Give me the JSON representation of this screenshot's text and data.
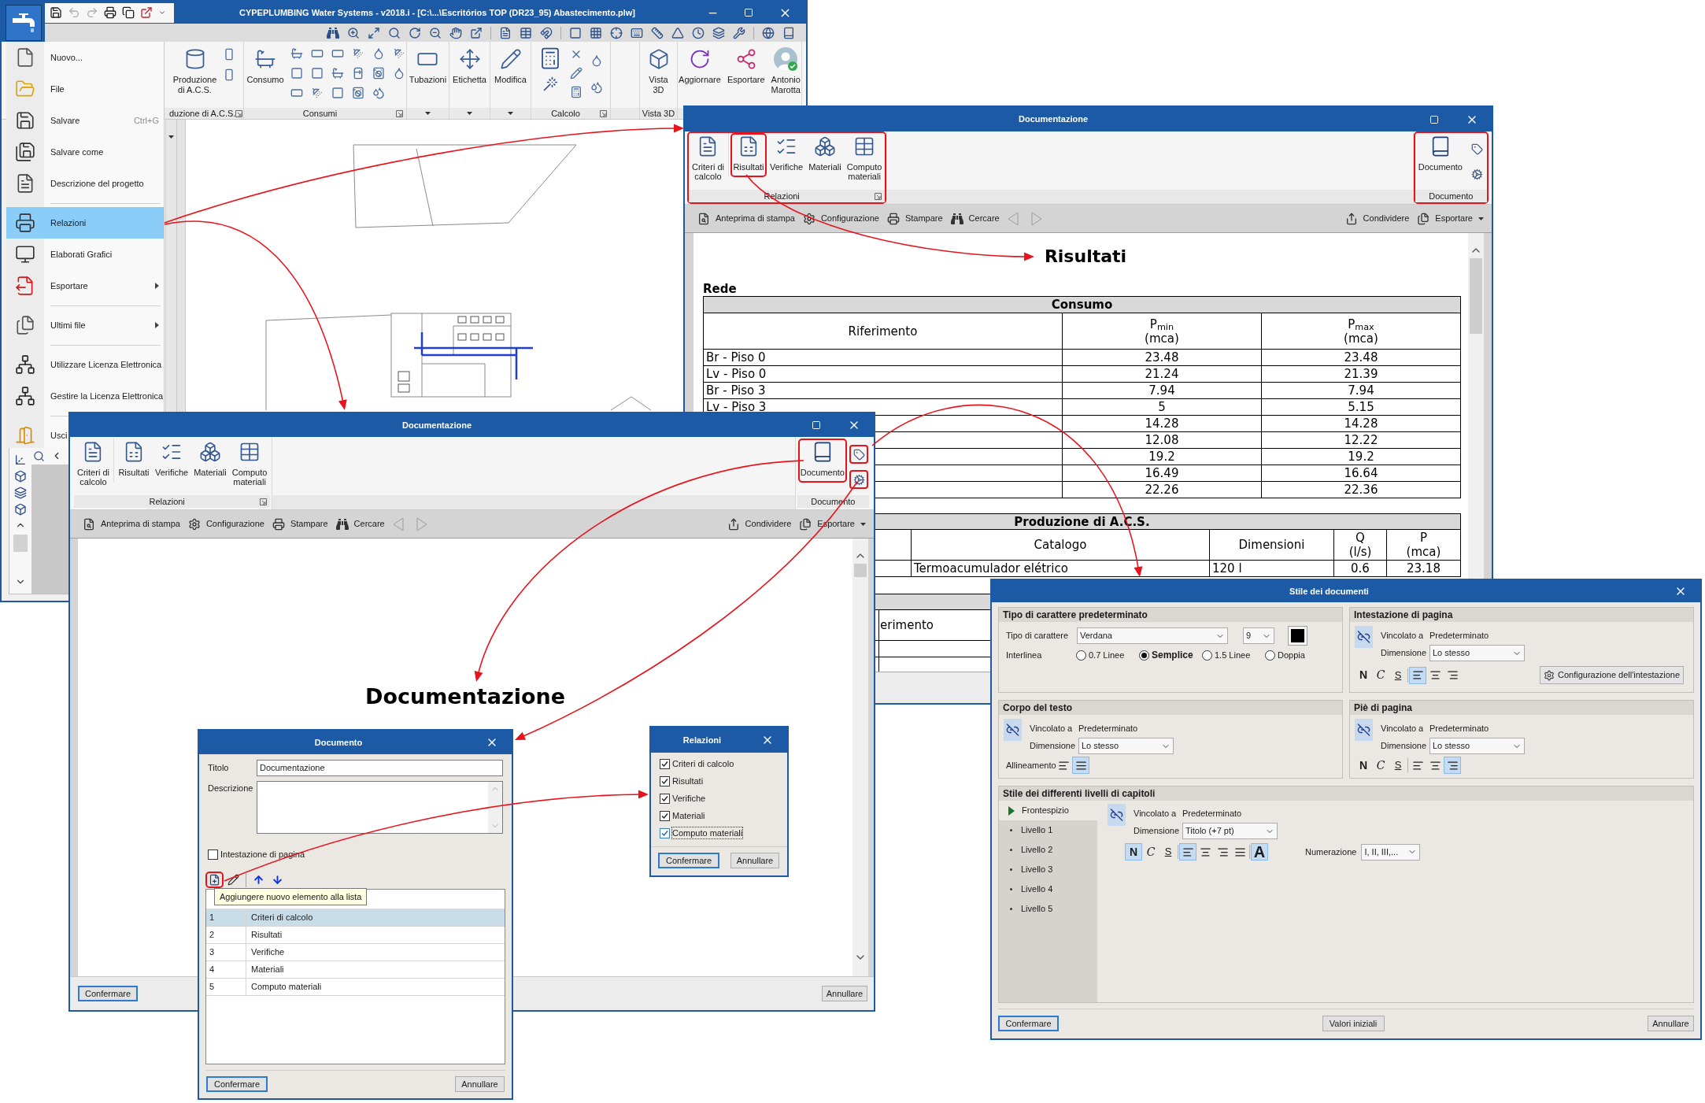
{
  "main_window": {
    "title": "CYPEPLUMBING Water Systems - v2018.i - [C:\\...\\Escritórios TOP (DR23_95) Abastecimento.plw]",
    "quick_access": [
      {
        "disabled": false
      },
      {
        "disabled": true
      },
      {
        "disabled": true
      },
      {
        "disabled": false
      },
      {
        "disabled": false
      },
      {
        "disabled": false
      }
    ],
    "ribbon_groups": [
      {
        "kind": "acs",
        "label": "duzione di A.C.S.",
        "launcher": true,
        "dropdown": false,
        "buttons": [
          "Produzione\ndi A.C.S."
        ]
      },
      {
        "kind": "consumption",
        "label": "Consumi",
        "launcher": true,
        "dropdown": false,
        "buttons": [
          "Consumo"
        ]
      },
      {
        "kind": "pipes",
        "launcher": false,
        "dropdown": true,
        "buttons": [
          "Tubazioni"
        ]
      },
      {
        "kind": "labels",
        "launcher": false,
        "dropdown": true,
        "buttons": [
          "Etichetta"
        ]
      },
      {
        "kind": "edit",
        "launcher": false,
        "dropdown": true,
        "buttons": [
          "Modifica"
        ]
      },
      {
        "kind": "calc",
        "label": "Calcolo",
        "launcher": true,
        "dropdown": false
      },
      {
        "kind": "view",
        "label": "Vista 3D",
        "launcher": false,
        "dropdown": false,
        "buttons": [
          "Vista\n3D"
        ]
      },
      {
        "kind": "share",
        "buttons": [
          "Aggiornare",
          "Esportare",
          "Antonio\nMarotta"
        ]
      }
    ],
    "app_menu": [
      {
        "label": "Nuovo...",
        "selected": false,
        "submenu": false,
        "divider": false
      },
      {
        "label": "File",
        "selected": false,
        "submenu": false,
        "divider": false
      },
      {
        "label": "Salvare",
        "shortcut": "Ctrl+G",
        "selected": false,
        "submenu": false,
        "divider": false
      },
      {
        "label": "Salvare come",
        "selected": false,
        "submenu": false,
        "divider": false
      },
      {
        "label": "Descrizione del progetto",
        "selected": false,
        "submenu": false,
        "divider": true
      },
      {
        "label": "Relazioni",
        "selected": true,
        "submenu": false,
        "divider": false
      },
      {
        "label": "Elaborati Grafici",
        "selected": false,
        "submenu": false,
        "divider": false
      },
      {
        "label": "Esportare",
        "selected": false,
        "submenu": true,
        "divider": true
      },
      {
        "label": "Ultimi file",
        "selected": false,
        "submenu": true,
        "divider": true
      },
      {
        "label": "Utilizzare Licenza Elettronica",
        "selected": false,
        "submenu": false,
        "divider": false
      },
      {
        "label": "Gestire la Licenza Elettronica",
        "selected": false,
        "submenu": false,
        "divider": true
      },
      {
        "label": "Usci",
        "selected": false,
        "submenu": false,
        "divider": false
      }
    ]
  },
  "report_window": {
    "title": "Documentazione",
    "ribbon_groups": [
      {
        "kind": "reports",
        "label": "Relazioni",
        "launcher": true,
        "highlighted": true,
        "buttons": [
          {
            "label": "Criteri di\ncalcolo",
            "highlighted": false
          },
          {
            "label": "Risultati",
            "highlighted": true
          },
          {
            "label": "Verifiche",
            "highlighted": false
          },
          {
            "label": "Materiali",
            "highlighted": false
          },
          {
            "label": "Computo\nmateriali",
            "highlighted": false
          }
        ]
      },
      {
        "kind": "document",
        "label": "Documento",
        "launcher": false,
        "highlighted": true,
        "buttons": [
          {
            "label": "Documento",
            "highlighted": false
          }
        ],
        "tools": [
          {
            "highlighted": false
          },
          {
            "highlighted": false
          }
        ]
      }
    ],
    "toolbar": {
      "left": [
        {
          "label": "Anteprima di stampa"
        },
        {
          "label": "Configurazione"
        },
        {
          "label": "Stampare"
        },
        {
          "label": "Cercare"
        }
      ],
      "nav": [
        {
          "disabled": true
        },
        {
          "disabled": true
        }
      ],
      "right": [
        {
          "label": "Condividere",
          "dropdown": false
        },
        {
          "label": "Esportare",
          "dropdown": true
        }
      ]
    },
    "document": {
      "heading": "Risultati",
      "section": "Rede",
      "tables": [
        {
          "title": "Consumo",
          "columns": [
            {
              "label": "Riferimento"
            },
            {
              "label": "P$_{min}$",
              "unit": "(mca)"
            },
            {
              "label": "P$_{max}$",
              "unit": "(mca)"
            }
          ],
          "rows": [
            [
              "Br - Piso 0",
              "23.48",
              "23.48"
            ],
            [
              "Lv - Piso 0",
              "21.24",
              "21.39"
            ],
            [
              "Br - Piso 3",
              "7.94",
              "7.94"
            ],
            [
              "Lv - Piso 3",
              "5",
              "5.15"
            ],
            [
              null,
              "14.28",
              "14.28"
            ],
            [
              null,
              "12.08",
              "12.22"
            ],
            [
              null,
              "19.2",
              "19.2"
            ],
            [
              null,
              "16.49",
              "16.64"
            ],
            [
              null,
              "22.26",
              "22.36"
            ]
          ]
        },
        {
          "title": "Produzione di A.C.S.",
          "columns": [
            {},
            {
              "label": "Catalogo"
            },
            {
              "label": "Dimensioni"
            },
            {
              "label": "Q",
              "unit": "(l/s)"
            },
            {
              "label": "P",
              "unit": "(mca)"
            }
          ],
          "rows": [
            [
              null,
              "Termoacumulador elétrico",
              "120 l",
              "0.6",
              "23.18"
            ]
          ]
        },
        {
          "columns": [
            {},
            {
              "label": "erimento"
            }
          ],
          "rows": [
            [
              null,
              null
            ],
            [
              null,
              null
            ]
          ]
        }
      ]
    }
  },
  "document_window": {
    "title": "Documentazione",
    "ribbon_groups": [
      {
        "kind": "reports",
        "label": "Relazioni",
        "launcher": true,
        "highlighted": false,
        "buttons": [
          {
            "label": "Criteri di\ncalcolo",
            "highlighted": false
          },
          {
            "label": "Risultati",
            "highlighted": false
          },
          {
            "label": "Verifiche",
            "highlighted": false
          },
          {
            "label": "Materiali",
            "highlighted": false
          },
          {
            "label": "Computo\nmateriali",
            "highlighted": false
          }
        ]
      },
      {
        "kind": "document",
        "label": "Documento",
        "launcher": false,
        "highlighted": false,
        "buttons": [
          {
            "label": "Documento",
            "highlighted": true
          }
        ],
        "tools": [
          {
            "highlighted": true
          },
          {
            "highlighted": true
          }
        ]
      }
    ],
    "toolbar": {
      "left": [
        {
          "label": "Anteprima di stampa"
        },
        {
          "label": "Configurazione"
        },
        {
          "label": "Stampare"
        },
        {
          "label": "Cercare"
        }
      ],
      "nav": [
        {
          "disabled": true
        },
        {
          "disabled": true
        }
      ],
      "right": [
        {
          "label": "Condividere",
          "dropdown": false
        },
        {
          "label": "Esportare",
          "dropdown": true
        }
      ]
    },
    "document": {
      "heading": "Documentazione"
    },
    "footer_buttons": [
      {
        "label": "Confermare",
        "default": true
      },
      {
        "label": "Annullare",
        "default": false
      }
    ]
  },
  "documento_dialog": {
    "title": "Documento",
    "fields": [
      {
        "label": "Titolo",
        "value": "Documentazione"
      },
      {
        "label": "Descrizione"
      }
    ],
    "header_option": {
      "label": "Intestazione di pagina",
      "checked": false
    },
    "tools": [
      {
        "highlighted": true
      },
      {
        "highlighted": false
      },
      {
        "highlighted": false
      },
      {
        "highlighted": false
      }
    ],
    "tooltip": "Aggiungere nuovo elemento alla lista",
    "items": [
      {
        "number": "1",
        "label": "Criteri di calcolo",
        "selected": true
      },
      {
        "number": "2",
        "label": "Risultati",
        "selected": false
      },
      {
        "number": "3",
        "label": "Verifiche",
        "selected": false
      },
      {
        "number": "4",
        "label": "Materiali",
        "selected": false
      },
      {
        "number": "5",
        "label": "Computo materiali",
        "selected": false
      }
    ],
    "buttons": [
      {
        "label": "Confermare",
        "default": true
      },
      {
        "label": "Annullare",
        "default": false
      }
    ]
  },
  "relazioni_dialog": {
    "title": "Relazioni",
    "options": [
      {
        "label": "Criteri di calcolo",
        "checked": true,
        "focused": false
      },
      {
        "label": "Risultati",
        "checked": true,
        "focused": false
      },
      {
        "label": "Verifiche",
        "checked": true,
        "focused": false
      },
      {
        "label": "Materiali",
        "checked": true,
        "focused": false
      },
      {
        "label": "Computo materiali",
        "checked": true,
        "focused": true
      }
    ],
    "buttons": [
      {
        "label": "Confermare",
        "default": true
      },
      {
        "label": "Annullare",
        "default": false
      }
    ]
  },
  "style_dialog": {
    "title": "Stile dei documenti",
    "font_section": {
      "title": "Tipo di carattere predeterminato",
      "font_label": "Tipo di carattere",
      "font": "Verdana",
      "size": "9",
      "color": "#000000",
      "spacing_label": "Interlinea",
      "spacing_options": [
        {
          "label": "0.7 Linee",
          "selected": false
        },
        {
          "label": "Semplice",
          "selected": true
        },
        {
          "label": "1.5 Linee",
          "selected": false
        },
        {
          "label": "Doppia",
          "selected": false
        }
      ]
    },
    "header_section": {
      "title": "Intestazione di pagina",
      "link_label": "Vincolato a",
      "link_value": "Predeterminato",
      "size_label": "Dimensione",
      "size": "Lo stesso",
      "styles": [
        {
          "label": "N",
          "selected": false
        },
        {
          "label": "C",
          "selected": false
        },
        {
          "label": "S",
          "selected": false
        }
      ],
      "alignments": [
        {
          "kind": "left",
          "selected": true
        },
        {
          "kind": "center",
          "selected": false
        },
        {
          "kind": "right",
          "selected": false
        }
      ],
      "config_button": "Configurazione dell'intestazione"
    },
    "body_section": {
      "title": "Corpo del testo",
      "link_label": "Vincolato a",
      "link_value": "Predeterminato",
      "size_label": "Dimensione",
      "size": "Lo stesso",
      "alignment_label": "Allineamento",
      "alignments": [
        {
          "kind": "left",
          "selected": false
        },
        {
          "kind": "justify",
          "selected": true
        }
      ]
    },
    "footer_section": {
      "title": "Piè di pagina",
      "link_label": "Vincolato a",
      "link_value": "Predeterminato",
      "size_label": "Dimensione",
      "size": "Lo stesso",
      "styles": [
        {
          "label": "N",
          "selected": false
        },
        {
          "label": "C",
          "selected": false
        },
        {
          "label": "S",
          "selected": false
        }
      ],
      "alignments": [
        {
          "kind": "left",
          "selected": false
        },
        {
          "kind": "center",
          "selected": false
        },
        {
          "kind": "right",
          "selected": true
        }
      ]
    },
    "levels_section": {
      "title": "Stile dei differenti livelli di capitoli",
      "levels": [
        {
          "label": "Frontespizio",
          "selected": true
        },
        {
          "label": "Livello 1",
          "selected": false
        },
        {
          "label": "Livello 2",
          "selected": false
        },
        {
          "label": "Livello 3",
          "selected": false
        },
        {
          "label": "Livello 4",
          "selected": false
        },
        {
          "label": "Livello 5",
          "selected": false
        }
      ],
      "link_label": "Vincolato a",
      "link_value": "Predeterminato",
      "size_label": "Dimensione",
      "size": "Titolo (+7 pt)",
      "styles": [
        {
          "label": "N",
          "selected": true
        },
        {
          "label": "C",
          "selected": false
        },
        {
          "label": "S",
          "selected": false
        }
      ],
      "alignments": [
        {
          "kind": "left",
          "selected": true
        },
        {
          "kind": "center",
          "selected": false
        },
        {
          "kind": "right",
          "selected": false
        },
        {
          "kind": "justify",
          "selected": false
        }
      ],
      "case_button": {
        "label": "A",
        "selected": true
      },
      "numbering_label": "Numerazione",
      "numbering": "I, II, III,..."
    },
    "buttons": [
      {
        "label": "Confermare",
        "default": true
      },
      {
        "label": "Valori iniziali",
        "default": false
      },
      {
        "label": "Annullare",
        "default": false
      }
    ]
  }
}
